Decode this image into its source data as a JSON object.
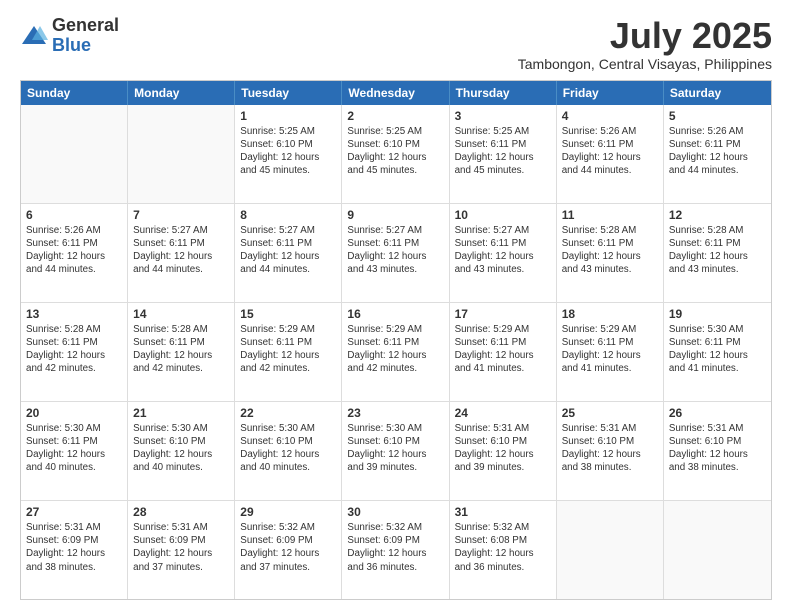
{
  "logo": {
    "general": "General",
    "blue": "Blue"
  },
  "title": "July 2025",
  "subtitle": "Tambongon, Central Visayas, Philippines",
  "header_days": [
    "Sunday",
    "Monday",
    "Tuesday",
    "Wednesday",
    "Thursday",
    "Friday",
    "Saturday"
  ],
  "weeks": [
    [
      {
        "day": "",
        "text": "",
        "empty": true
      },
      {
        "day": "",
        "text": "",
        "empty": true
      },
      {
        "day": "1",
        "text": "Sunrise: 5:25 AM\nSunset: 6:10 PM\nDaylight: 12 hours and 45 minutes."
      },
      {
        "day": "2",
        "text": "Sunrise: 5:25 AM\nSunset: 6:10 PM\nDaylight: 12 hours and 45 minutes."
      },
      {
        "day": "3",
        "text": "Sunrise: 5:25 AM\nSunset: 6:11 PM\nDaylight: 12 hours and 45 minutes."
      },
      {
        "day": "4",
        "text": "Sunrise: 5:26 AM\nSunset: 6:11 PM\nDaylight: 12 hours and 44 minutes."
      },
      {
        "day": "5",
        "text": "Sunrise: 5:26 AM\nSunset: 6:11 PM\nDaylight: 12 hours and 44 minutes."
      }
    ],
    [
      {
        "day": "6",
        "text": "Sunrise: 5:26 AM\nSunset: 6:11 PM\nDaylight: 12 hours and 44 minutes."
      },
      {
        "day": "7",
        "text": "Sunrise: 5:27 AM\nSunset: 6:11 PM\nDaylight: 12 hours and 44 minutes."
      },
      {
        "day": "8",
        "text": "Sunrise: 5:27 AM\nSunset: 6:11 PM\nDaylight: 12 hours and 44 minutes."
      },
      {
        "day": "9",
        "text": "Sunrise: 5:27 AM\nSunset: 6:11 PM\nDaylight: 12 hours and 43 minutes."
      },
      {
        "day": "10",
        "text": "Sunrise: 5:27 AM\nSunset: 6:11 PM\nDaylight: 12 hours and 43 minutes."
      },
      {
        "day": "11",
        "text": "Sunrise: 5:28 AM\nSunset: 6:11 PM\nDaylight: 12 hours and 43 minutes."
      },
      {
        "day": "12",
        "text": "Sunrise: 5:28 AM\nSunset: 6:11 PM\nDaylight: 12 hours and 43 minutes."
      }
    ],
    [
      {
        "day": "13",
        "text": "Sunrise: 5:28 AM\nSunset: 6:11 PM\nDaylight: 12 hours and 42 minutes."
      },
      {
        "day": "14",
        "text": "Sunrise: 5:28 AM\nSunset: 6:11 PM\nDaylight: 12 hours and 42 minutes."
      },
      {
        "day": "15",
        "text": "Sunrise: 5:29 AM\nSunset: 6:11 PM\nDaylight: 12 hours and 42 minutes."
      },
      {
        "day": "16",
        "text": "Sunrise: 5:29 AM\nSunset: 6:11 PM\nDaylight: 12 hours and 42 minutes."
      },
      {
        "day": "17",
        "text": "Sunrise: 5:29 AM\nSunset: 6:11 PM\nDaylight: 12 hours and 41 minutes."
      },
      {
        "day": "18",
        "text": "Sunrise: 5:29 AM\nSunset: 6:11 PM\nDaylight: 12 hours and 41 minutes."
      },
      {
        "day": "19",
        "text": "Sunrise: 5:30 AM\nSunset: 6:11 PM\nDaylight: 12 hours and 41 minutes."
      }
    ],
    [
      {
        "day": "20",
        "text": "Sunrise: 5:30 AM\nSunset: 6:11 PM\nDaylight: 12 hours and 40 minutes."
      },
      {
        "day": "21",
        "text": "Sunrise: 5:30 AM\nSunset: 6:10 PM\nDaylight: 12 hours and 40 minutes."
      },
      {
        "day": "22",
        "text": "Sunrise: 5:30 AM\nSunset: 6:10 PM\nDaylight: 12 hours and 40 minutes."
      },
      {
        "day": "23",
        "text": "Sunrise: 5:30 AM\nSunset: 6:10 PM\nDaylight: 12 hours and 39 minutes."
      },
      {
        "day": "24",
        "text": "Sunrise: 5:31 AM\nSunset: 6:10 PM\nDaylight: 12 hours and 39 minutes."
      },
      {
        "day": "25",
        "text": "Sunrise: 5:31 AM\nSunset: 6:10 PM\nDaylight: 12 hours and 38 minutes."
      },
      {
        "day": "26",
        "text": "Sunrise: 5:31 AM\nSunset: 6:10 PM\nDaylight: 12 hours and 38 minutes."
      }
    ],
    [
      {
        "day": "27",
        "text": "Sunrise: 5:31 AM\nSunset: 6:09 PM\nDaylight: 12 hours and 38 minutes."
      },
      {
        "day": "28",
        "text": "Sunrise: 5:31 AM\nSunset: 6:09 PM\nDaylight: 12 hours and 37 minutes."
      },
      {
        "day": "29",
        "text": "Sunrise: 5:32 AM\nSunset: 6:09 PM\nDaylight: 12 hours and 37 minutes."
      },
      {
        "day": "30",
        "text": "Sunrise: 5:32 AM\nSunset: 6:09 PM\nDaylight: 12 hours and 36 minutes."
      },
      {
        "day": "31",
        "text": "Sunrise: 5:32 AM\nSunset: 6:08 PM\nDaylight: 12 hours and 36 minutes."
      },
      {
        "day": "",
        "text": "",
        "empty": true
      },
      {
        "day": "",
        "text": "",
        "empty": true
      }
    ]
  ]
}
